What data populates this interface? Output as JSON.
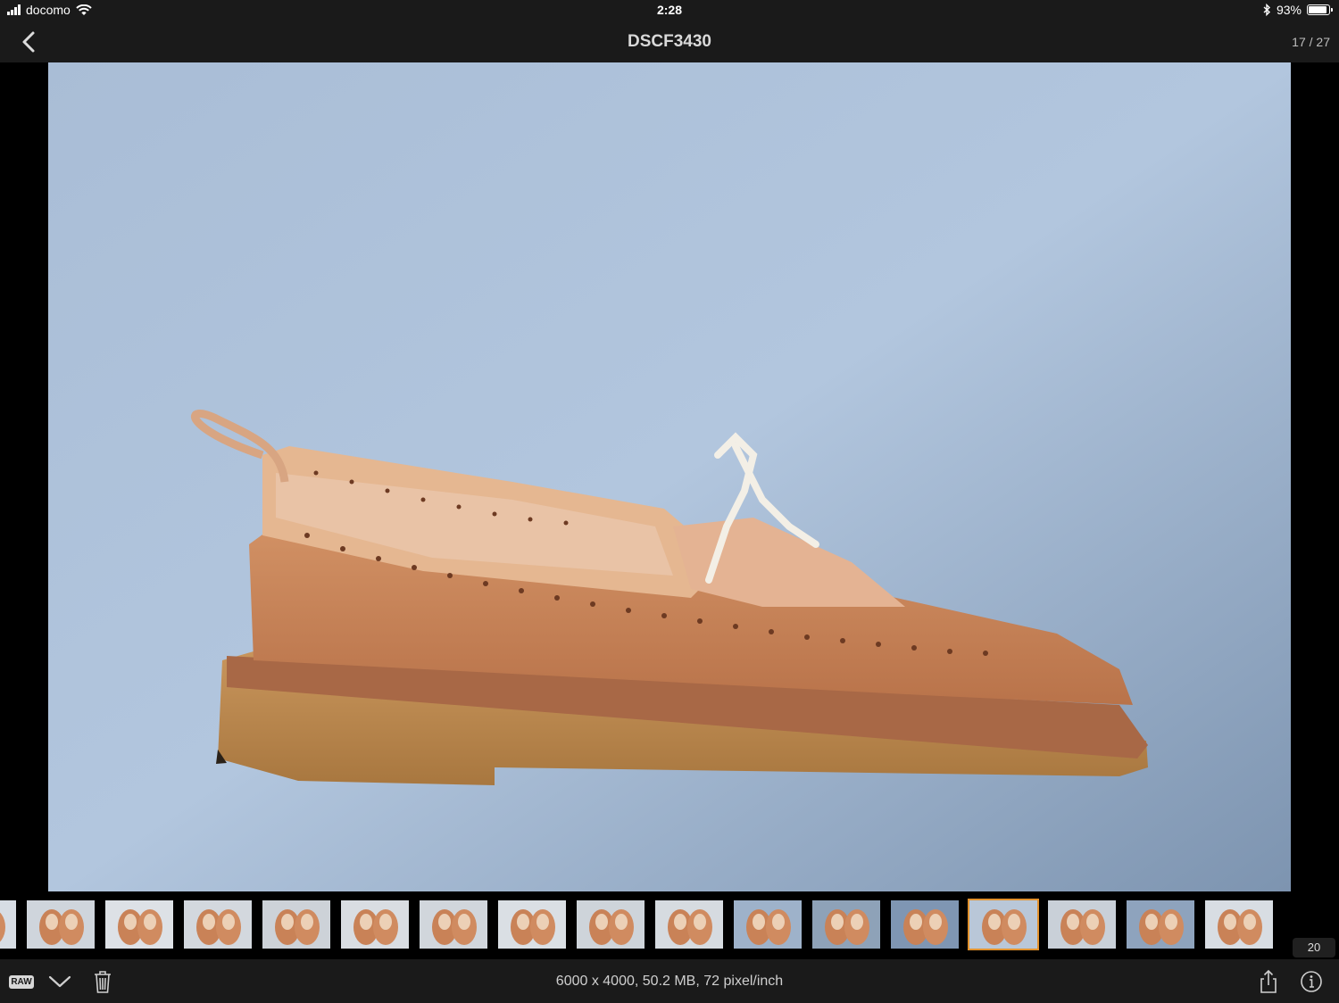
{
  "status_bar": {
    "carrier": "docomo",
    "time": "2:28",
    "battery": "93%",
    "battery_level": 0.93
  },
  "nav": {
    "title": "DSCF3430",
    "counter": "17 / 27"
  },
  "rating": {
    "stars": [
      "☆",
      "☆",
      "☆",
      "☆",
      "☆"
    ],
    "value": 0
  },
  "filmstrip": {
    "badge": "20",
    "selected_index": 13
  },
  "toolbar": {
    "raw_label": "RAW",
    "info": "6000 x 4000, 50.2 MB, 72 pixel/inch"
  },
  "colors": {
    "accent": "#e2922e",
    "bar_bg": "#1a1a1a"
  }
}
